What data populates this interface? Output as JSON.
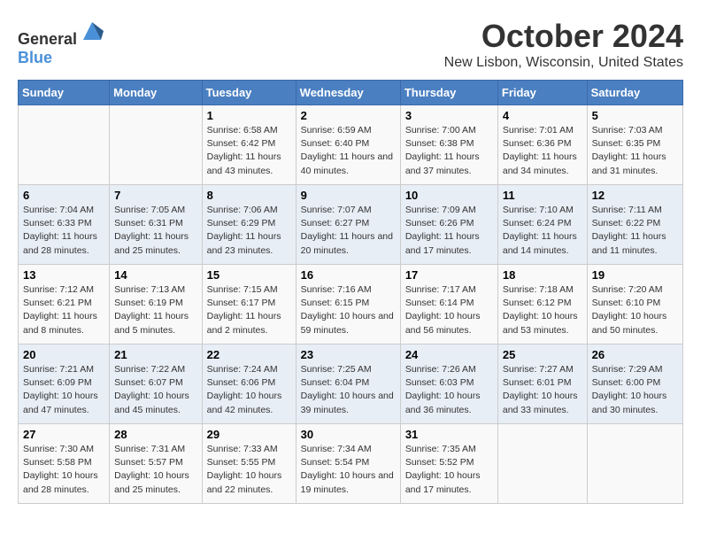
{
  "header": {
    "logo_general": "General",
    "logo_blue": "Blue",
    "month": "October 2024",
    "location": "New Lisbon, Wisconsin, United States"
  },
  "days_of_week": [
    "Sunday",
    "Monday",
    "Tuesday",
    "Wednesday",
    "Thursday",
    "Friday",
    "Saturday"
  ],
  "weeks": [
    [
      {
        "day": "",
        "info": ""
      },
      {
        "day": "",
        "info": ""
      },
      {
        "day": "1",
        "info": "Sunrise: 6:58 AM\nSunset: 6:42 PM\nDaylight: 11 hours and 43 minutes."
      },
      {
        "day": "2",
        "info": "Sunrise: 6:59 AM\nSunset: 6:40 PM\nDaylight: 11 hours and 40 minutes."
      },
      {
        "day": "3",
        "info": "Sunrise: 7:00 AM\nSunset: 6:38 PM\nDaylight: 11 hours and 37 minutes."
      },
      {
        "day": "4",
        "info": "Sunrise: 7:01 AM\nSunset: 6:36 PM\nDaylight: 11 hours and 34 minutes."
      },
      {
        "day": "5",
        "info": "Sunrise: 7:03 AM\nSunset: 6:35 PM\nDaylight: 11 hours and 31 minutes."
      }
    ],
    [
      {
        "day": "6",
        "info": "Sunrise: 7:04 AM\nSunset: 6:33 PM\nDaylight: 11 hours and 28 minutes."
      },
      {
        "day": "7",
        "info": "Sunrise: 7:05 AM\nSunset: 6:31 PM\nDaylight: 11 hours and 25 minutes."
      },
      {
        "day": "8",
        "info": "Sunrise: 7:06 AM\nSunset: 6:29 PM\nDaylight: 11 hours and 23 minutes."
      },
      {
        "day": "9",
        "info": "Sunrise: 7:07 AM\nSunset: 6:27 PM\nDaylight: 11 hours and 20 minutes."
      },
      {
        "day": "10",
        "info": "Sunrise: 7:09 AM\nSunset: 6:26 PM\nDaylight: 11 hours and 17 minutes."
      },
      {
        "day": "11",
        "info": "Sunrise: 7:10 AM\nSunset: 6:24 PM\nDaylight: 11 hours and 14 minutes."
      },
      {
        "day": "12",
        "info": "Sunrise: 7:11 AM\nSunset: 6:22 PM\nDaylight: 11 hours and 11 minutes."
      }
    ],
    [
      {
        "day": "13",
        "info": "Sunrise: 7:12 AM\nSunset: 6:21 PM\nDaylight: 11 hours and 8 minutes."
      },
      {
        "day": "14",
        "info": "Sunrise: 7:13 AM\nSunset: 6:19 PM\nDaylight: 11 hours and 5 minutes."
      },
      {
        "day": "15",
        "info": "Sunrise: 7:15 AM\nSunset: 6:17 PM\nDaylight: 11 hours and 2 minutes."
      },
      {
        "day": "16",
        "info": "Sunrise: 7:16 AM\nSunset: 6:15 PM\nDaylight: 10 hours and 59 minutes."
      },
      {
        "day": "17",
        "info": "Sunrise: 7:17 AM\nSunset: 6:14 PM\nDaylight: 10 hours and 56 minutes."
      },
      {
        "day": "18",
        "info": "Sunrise: 7:18 AM\nSunset: 6:12 PM\nDaylight: 10 hours and 53 minutes."
      },
      {
        "day": "19",
        "info": "Sunrise: 7:20 AM\nSunset: 6:10 PM\nDaylight: 10 hours and 50 minutes."
      }
    ],
    [
      {
        "day": "20",
        "info": "Sunrise: 7:21 AM\nSunset: 6:09 PM\nDaylight: 10 hours and 47 minutes."
      },
      {
        "day": "21",
        "info": "Sunrise: 7:22 AM\nSunset: 6:07 PM\nDaylight: 10 hours and 45 minutes."
      },
      {
        "day": "22",
        "info": "Sunrise: 7:24 AM\nSunset: 6:06 PM\nDaylight: 10 hours and 42 minutes."
      },
      {
        "day": "23",
        "info": "Sunrise: 7:25 AM\nSunset: 6:04 PM\nDaylight: 10 hours and 39 minutes."
      },
      {
        "day": "24",
        "info": "Sunrise: 7:26 AM\nSunset: 6:03 PM\nDaylight: 10 hours and 36 minutes."
      },
      {
        "day": "25",
        "info": "Sunrise: 7:27 AM\nSunset: 6:01 PM\nDaylight: 10 hours and 33 minutes."
      },
      {
        "day": "26",
        "info": "Sunrise: 7:29 AM\nSunset: 6:00 PM\nDaylight: 10 hours and 30 minutes."
      }
    ],
    [
      {
        "day": "27",
        "info": "Sunrise: 7:30 AM\nSunset: 5:58 PM\nDaylight: 10 hours and 28 minutes."
      },
      {
        "day": "28",
        "info": "Sunrise: 7:31 AM\nSunset: 5:57 PM\nDaylight: 10 hours and 25 minutes."
      },
      {
        "day": "29",
        "info": "Sunrise: 7:33 AM\nSunset: 5:55 PM\nDaylight: 10 hours and 22 minutes."
      },
      {
        "day": "30",
        "info": "Sunrise: 7:34 AM\nSunset: 5:54 PM\nDaylight: 10 hours and 19 minutes."
      },
      {
        "day": "31",
        "info": "Sunrise: 7:35 AM\nSunset: 5:52 PM\nDaylight: 10 hours and 17 minutes."
      },
      {
        "day": "",
        "info": ""
      },
      {
        "day": "",
        "info": ""
      }
    ]
  ]
}
